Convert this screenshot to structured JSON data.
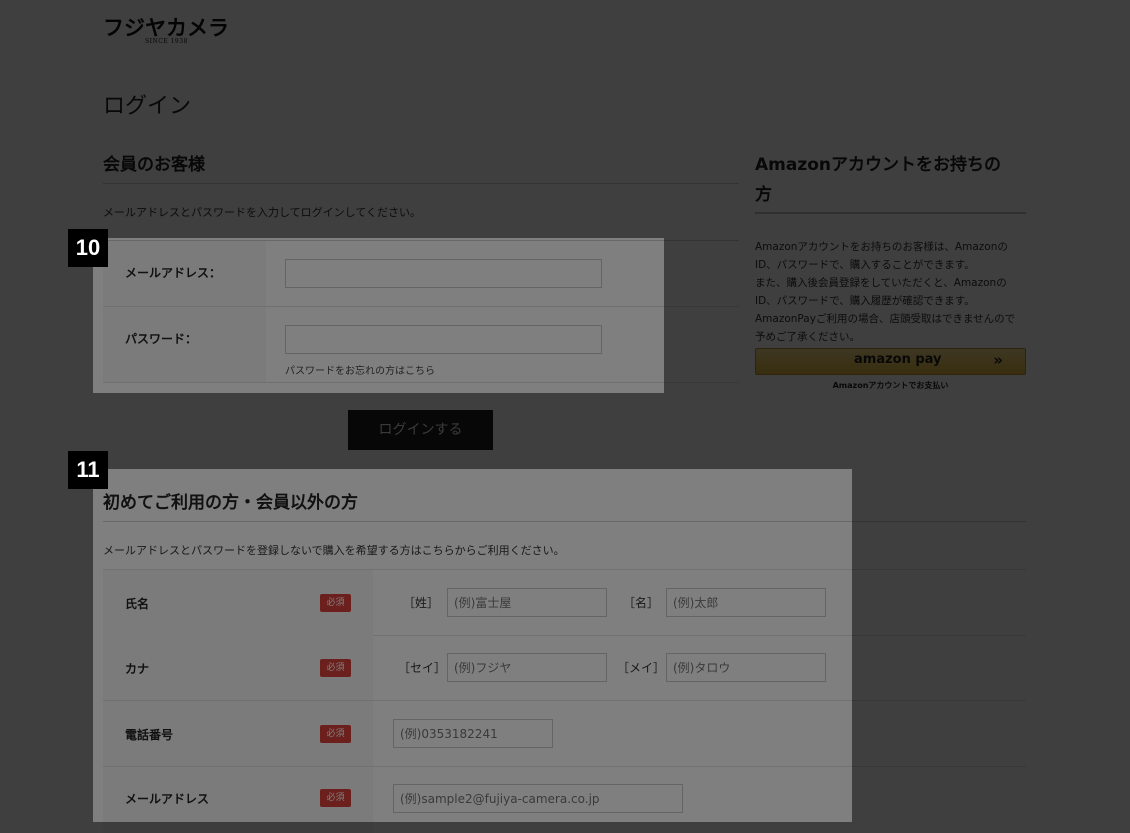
{
  "logo": {
    "text": "フジヤカメラ",
    "sub": "SINCE 1938"
  },
  "page_title": "ログイン",
  "member": {
    "heading": "会員のお客様",
    "description": "メールアドレスとパスワードを入力してログインしてください。",
    "email_label": "メールアドレス：",
    "password_label": "パスワード：",
    "forgot_link": "パスワードをお忘れの方はこちら",
    "login_button": "ログインする"
  },
  "amazon": {
    "heading_line1": "Amazonアカウントをお持ちの",
    "heading_line2": "方",
    "desc_lines": [
      "Amazonアカウントをお持ちのお客様は、Amazonの",
      "ID、パスワードで、購入することができます。",
      "また、購入後会員登録をしていただくと、Amazonの",
      "ID、パスワードで、購入履歴が確認できます。",
      "AmazonPayご利用の場合、店頭受取はできませんので",
      "予めご了承ください。"
    ],
    "button_logo": "amazon pay",
    "button_arrow": "»",
    "caption": "Amazonアカウントでお支払い",
    "button_color": "#e9c14f"
  },
  "guest": {
    "heading": "初めてご利用の方・会員以外の方",
    "description": "メールアドレスとパスワードを登録しないで購入を希望する方はこちらからご利用ください。",
    "required_badge": "必須",
    "rows": {
      "name": {
        "label": "氏名",
        "last_bracket": "［姓］",
        "last_placeholder": "(例)富士屋",
        "first_bracket": "［名］",
        "first_placeholder": "(例)太郎"
      },
      "kana": {
        "label": "カナ",
        "last_bracket": "［セイ］",
        "last_placeholder": "(例)フジヤ",
        "first_bracket": "［メイ］",
        "first_placeholder": "(例)タロウ"
      },
      "phone": {
        "label": "電話番号",
        "placeholder": "(例)0353182241"
      },
      "email": {
        "label": "メールアドレス",
        "placeholder": "(例)sample2@fujiya-camera.co.jp"
      }
    }
  },
  "annotations": {
    "tag1": "10",
    "tag2": "11"
  },
  "colors": {
    "overlay": "rgba(0,0,0,0.5)",
    "badge_red": "#d9403a",
    "login_button": "#1c1c1c"
  }
}
